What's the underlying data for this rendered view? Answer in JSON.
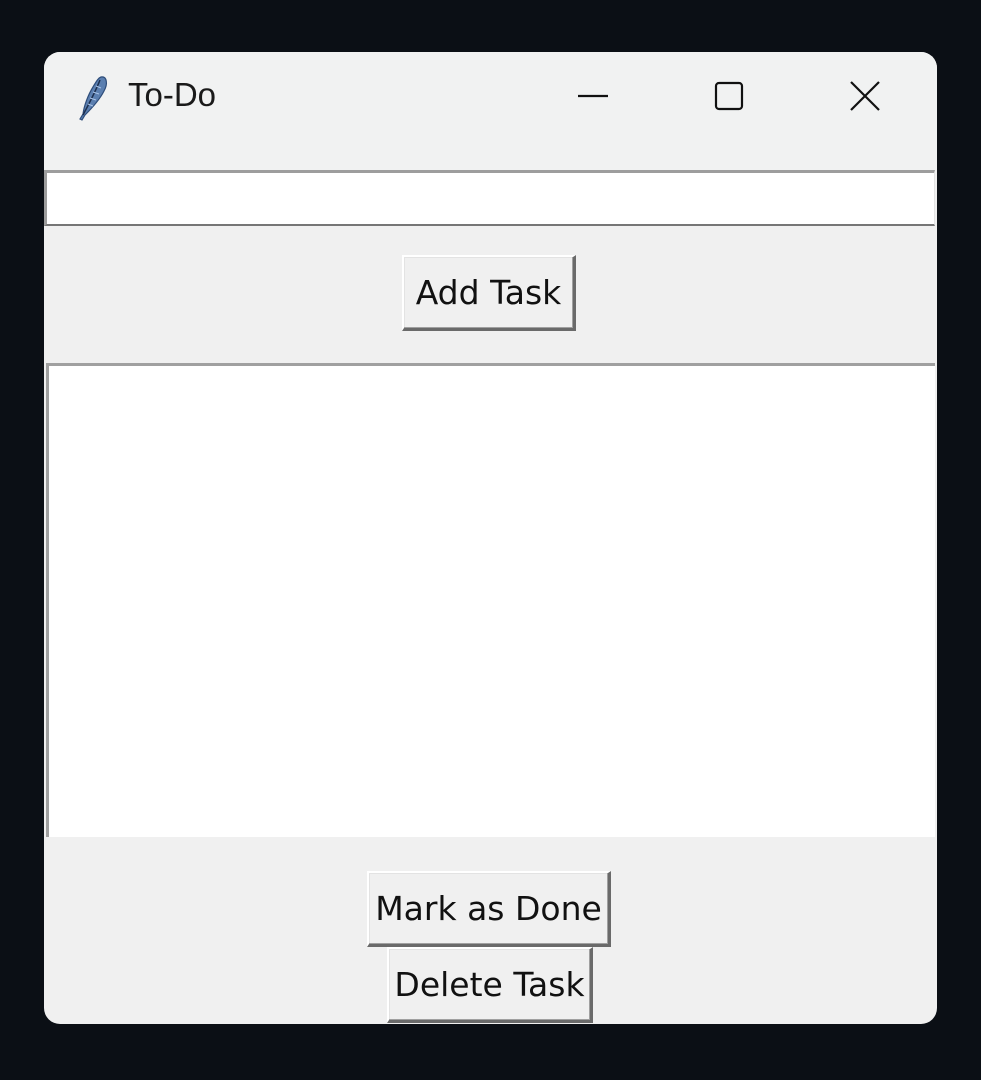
{
  "window": {
    "title": "To-Do",
    "icon": "feather-icon",
    "controls": {
      "minimize": "minimize-icon",
      "maximize": "maximize-icon",
      "close": "close-icon"
    }
  },
  "task_entry": {
    "value": "",
    "placeholder": ""
  },
  "add_button": {
    "label": "Add Task"
  },
  "task_list": {
    "items": []
  },
  "mark_done_button": {
    "label": "Mark as Done"
  },
  "delete_button": {
    "label": "Delete Task"
  },
  "colors": {
    "desktop": "#0b0f15",
    "window_bg": "#f0f0f0",
    "titlebar_bg": "#f1f2f2",
    "field_bg": "#ffffff"
  }
}
